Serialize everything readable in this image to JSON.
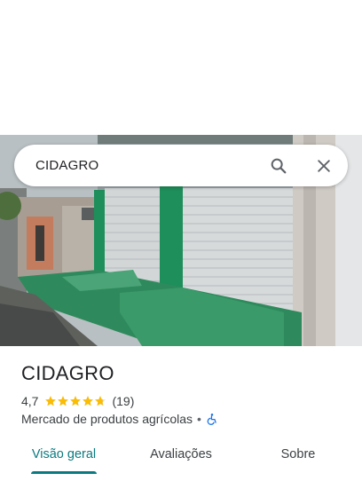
{
  "search": {
    "query": "CIDAGRO"
  },
  "place": {
    "name": "CIDAGRO",
    "rating_text": "4,7",
    "rating_value": 4.7,
    "rating_max": 5,
    "reviews_text": "(19)",
    "category": "Mercado de produtos agrícolas",
    "separator": "•",
    "accessibility_icon": "wheelchair-icon"
  },
  "tabs": [
    {
      "label": "Visão geral",
      "active": true
    },
    {
      "label": "Avaliações",
      "active": false
    },
    {
      "label": "Sobre",
      "active": false
    }
  ],
  "colors": {
    "accent": "#0b7a80",
    "star": "#fbbc04",
    "accessibility": "#1a73e8",
    "storefront_green": "#1e8f5a"
  }
}
